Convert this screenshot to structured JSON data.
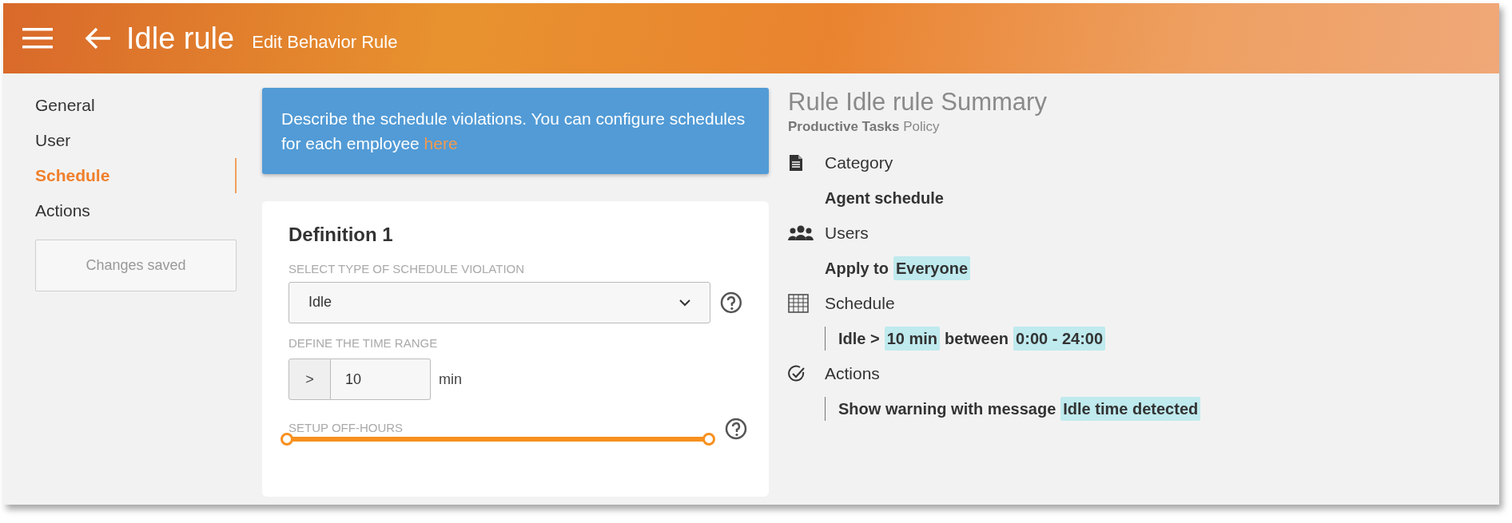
{
  "header": {
    "title": "Idle rule",
    "subtitle": "Edit Behavior Rule"
  },
  "sidebar": {
    "items": [
      {
        "label": "General",
        "selected": false
      },
      {
        "label": "User",
        "selected": false
      },
      {
        "label": "Schedule",
        "selected": true
      },
      {
        "label": "Actions",
        "selected": false
      }
    ],
    "status": "Changes saved"
  },
  "notice": {
    "text": "Describe the schedule violations. You can configure schedules for each employee",
    "link": "here"
  },
  "definition": {
    "title": "Definition 1",
    "violation_label": "SELECT TYPE OF SCHEDULE VIOLATION",
    "violation_value": "Idle",
    "range_label": "DEFINE THE TIME RANGE",
    "operator": ">",
    "minutes": "10",
    "unit": "min",
    "offhours_label": "SETUP OFF-HOURS",
    "offhours_thumbs": [
      {
        "level": 0
      },
      {
        "level": 1
      }
    ]
  },
  "summary": {
    "title": "Rule Idle rule Summary",
    "policy_name": "Productive Tasks",
    "policy_suffix": "Policy",
    "sections": [
      {
        "kind": "category",
        "heading": "Category",
        "boxed": false,
        "segments": [
          {
            "text": "Agent schedule",
            "highlight": false
          }
        ]
      },
      {
        "kind": "users",
        "heading": "Users",
        "boxed": false,
        "segments": [
          {
            "text": "Apply to",
            "highlight": false
          },
          {
            "text": "Everyone",
            "highlight": true
          }
        ]
      },
      {
        "kind": "schedule",
        "heading": "Schedule",
        "boxed": true,
        "segments": [
          {
            "text": "Idle >",
            "highlight": false
          },
          {
            "text": "10 min",
            "highlight": true
          },
          {
            "text": "between",
            "highlight": false
          },
          {
            "text": "0:00 - 24:00",
            "highlight": true
          }
        ]
      },
      {
        "kind": "actions",
        "heading": "Actions",
        "boxed": true,
        "segments": [
          {
            "text": "Show warning with message",
            "highlight": false
          },
          {
            "text": "Idle time detected",
            "highlight": true
          }
        ]
      }
    ]
  }
}
